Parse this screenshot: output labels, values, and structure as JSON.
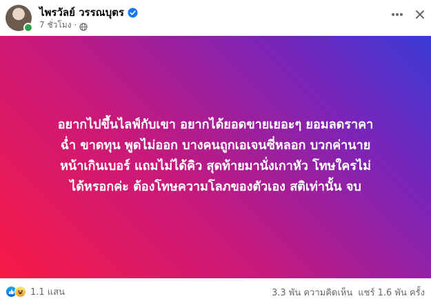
{
  "post": {
    "author": "ไพรวัลย์ วรรณบุตร",
    "time": "7 ชั่วโมง",
    "separator": "·",
    "icons": {
      "verified": "verified-badge-icon",
      "privacy": "globe-icon",
      "more": "more-horizontal-icon",
      "close": "close-icon"
    },
    "text_lines": [
      "อยากไปขึ้นไลฟ์กับเขา อยากได้ยอดขายเยอะๆ ยอมลดราคา",
      "ฉ่ำ ขาดทุน พูดไม่ออก บางคนถูกเอเจนซี่หลอก บวกค่านาย",
      "หน้าเกินเบอร์ แถมไม่ได้คิว สุดท้ายมานั่งเกาหัว โทษใครไม่",
      "ได้หรอกค่ะ ต้องโทษความโลภของตัวเอง สติเท่านั้น จบ"
    ],
    "background": {
      "from": "#f81a45",
      "to": "#3a3bd6"
    }
  },
  "footer": {
    "reaction_count": "1.1 แสน",
    "comments": "3.3 พัน ความคิดเห็น",
    "shares": "แชร์ 1.6 พัน ครั้ง",
    "reaction_icons": [
      "like-icon",
      "haha-icon"
    ]
  }
}
